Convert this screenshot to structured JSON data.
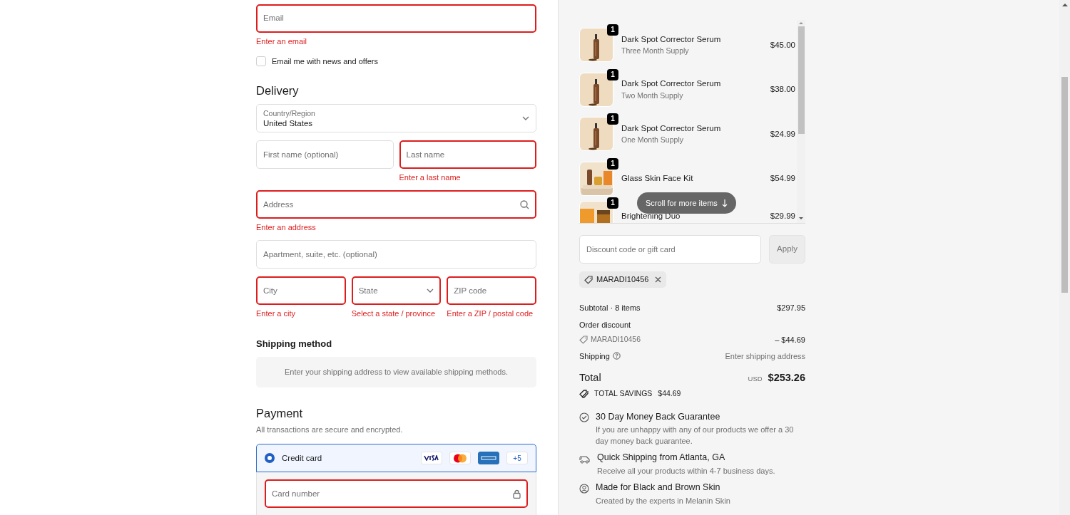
{
  "contact": {
    "email": {
      "placeholder": "Email",
      "invalid": true,
      "error": "Enter an email"
    },
    "newsletter": {
      "label": "Email me with news and offers",
      "checked": false
    }
  },
  "delivery": {
    "heading": "Delivery",
    "country": {
      "label": "Country/Region",
      "value": "United States"
    },
    "rows": [
      [
        {
          "kind": "text",
          "placeholder": "First name (optional)",
          "invalid": false
        },
        {
          "kind": "text",
          "placeholder": "Last name",
          "invalid": true,
          "error": "Enter a last name"
        }
      ],
      [
        {
          "kind": "search",
          "placeholder": "Address",
          "invalid": true,
          "error": "Enter an address"
        }
      ],
      [
        {
          "kind": "text",
          "placeholder": "Apartment, suite, etc. (optional)",
          "invalid": false
        }
      ],
      [
        {
          "kind": "text",
          "placeholder": "City",
          "invalid": true,
          "error": "Enter a city"
        },
        {
          "kind": "select",
          "placeholder": "State",
          "invalid": true,
          "error": "Select a state / province"
        },
        {
          "kind": "text",
          "placeholder": "ZIP code",
          "invalid": true,
          "error": "Enter a ZIP / postal code"
        }
      ]
    ]
  },
  "shipping_method": {
    "heading": "Shipping method",
    "message": "Enter your shipping address to view available shipping methods."
  },
  "payment": {
    "heading": "Payment",
    "note": "All transactions are secure and encrypted.",
    "method": {
      "label": "Credit card",
      "selected": true,
      "more_cards": "+5"
    },
    "card_number": {
      "placeholder": "Card number",
      "invalid": true
    }
  },
  "order": {
    "items": [
      {
        "name": "Dark Spot Corrector Serum",
        "variant": "Three Month Supply",
        "price": "$45.00",
        "quantity": "1"
      },
      {
        "name": "Dark Spot Corrector Serum",
        "variant": "Two Month Supply",
        "price": "$38.00",
        "quantity": "1"
      },
      {
        "name": "Dark Spot Corrector Serum",
        "variant": "One Month Supply",
        "price": "$24.99",
        "quantity": "1"
      },
      {
        "name": "Glass Skin Face Kit",
        "price": "$54.99",
        "quantity": "1"
      },
      {
        "name": "Brightening Duo",
        "price": "$29.99",
        "quantity": "1"
      }
    ],
    "scroll_hint": "Scroll for more items",
    "discount": {
      "placeholder": "Discount code or gift card",
      "button": "Apply"
    },
    "applied_code": "MARADI10456",
    "summary": {
      "subtotal_label": "Subtotal · 8 items",
      "subtotal": "$297.95",
      "discount_label": "Order discount",
      "discount_code": "MARADI10456",
      "discount_amount": "– $44.69",
      "shipping_label": "Shipping",
      "shipping_value": "Enter shipping address",
      "total_label": "Total",
      "currency": "USD",
      "total": "$253.26",
      "savings_label": "TOTAL SAVINGS",
      "savings": "$44.69"
    },
    "perks": [
      {
        "kind": "check",
        "title": "30 Day Money Back Guarantee",
        "text": "If you are unhappy with any of our products we offer a 30 day money back guarantee."
      },
      {
        "kind": "truck",
        "title": "Quick Shipping from Atlanta, GA",
        "text": "Receive all your products within 4-7 business days."
      },
      {
        "kind": "person",
        "title": "Made for Black and Brown Skin",
        "text": "Created by the experts in Melanin Skin"
      }
    ]
  }
}
